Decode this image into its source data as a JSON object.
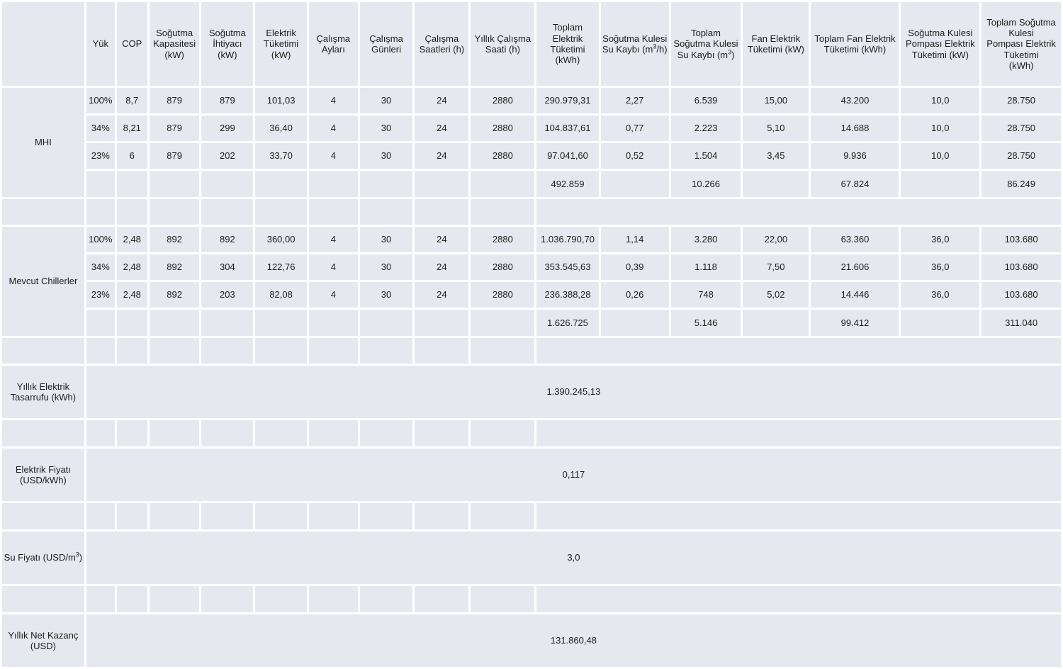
{
  "table": {
    "columns": [
      {
        "key": "group",
        "label": ""
      },
      {
        "key": "yuk",
        "label": "Yük"
      },
      {
        "key": "cop",
        "label": "COP"
      },
      {
        "key": "sogutma_kapasitesi",
        "label": "Soğutma Kapasitesi (kW)"
      },
      {
        "key": "sogutma_ihtiyaci",
        "label": "Soğutma İhtiyacı (kW)"
      },
      {
        "key": "elektrik_tuketimi",
        "label": "Elektrik Tüketimi (kW)"
      },
      {
        "key": "calisma_aylari",
        "label": "Çalışma Ayları"
      },
      {
        "key": "calisma_gunleri",
        "label": "Çalışma Günleri"
      },
      {
        "key": "calisma_saatleri",
        "label": "Çalışma Saatleri (h)"
      },
      {
        "key": "yillik_calisma_saati",
        "label": "Yıllık Çalışma Saati (h)"
      },
      {
        "key": "toplam_elektrik_tuketimi",
        "label": "Toplam Elektrik Tüketimi (kWh)"
      },
      {
        "key": "sk_su_kaybi",
        "label": "Soğutma Kulesi Su Kaybı (m³/h)"
      },
      {
        "key": "toplam_sk_su_kaybi",
        "label": "Toplam Soğutma Kulesi Su Kaybı (m³)"
      },
      {
        "key": "fan_elektrik_tuketimi",
        "label": "Fan Elektrik Tüketimi (kW)"
      },
      {
        "key": "toplam_fan_elektrik_tuketimi",
        "label": "Toplam Fan Elektrik Tüketimi (kWh)"
      },
      {
        "key": "sk_pompasi_elektrik_tuketimi",
        "label": "Soğutma Kulesi Pompası Elektrik Tüketimi (kW)"
      },
      {
        "key": "toplam_sk_pompasi_elektrik_tuketimi",
        "label": "Toplam Soğutma Kulesi Pompası Elektrik Tüketimi (kWh)"
      }
    ],
    "header_parts": {
      "c1": "Yük",
      "c2": "COP",
      "c3a": "Soğutma",
      "c3b": "Kapasitesi",
      "c3c": "(kW)",
      "c4a": "Soğutma",
      "c4b": "İhtiyacı (kW)",
      "c5a": "Elektrik",
      "c5b": "Tüketimi",
      "c5c": "(kW)",
      "c6a": "Çalışma",
      "c6b": "Ayları",
      "c7a": "Çalışma",
      "c7b": "Günleri",
      "c8a": "Çalışma",
      "c8b": "Saatleri (h)",
      "c9a": "Yıllık Çalışma",
      "c9b": "Saati (h)",
      "c10a": "Toplam Elektrik",
      "c10b": "Tüketimi (kWh)",
      "c11a": "Soğutma Kulesi",
      "c11b": "Su Kaybı (m",
      "c11sup": "3",
      "c11c": "/h)",
      "c12a": "Toplam",
      "c12b": "Soğutma Kulesi",
      "c12c": "Su Kaybı (m",
      "c12sup": "3",
      "c12d": ")",
      "c13a": "Fan Elektrik",
      "c13b": "Tüketimi (kW)",
      "c14a": "Toplam Fan Elektrik",
      "c14b": "Tüketimi (kWh)",
      "c15a": "Soğutma Kulesi",
      "c15b": "Pompası Elektrik",
      "c15c": "Tüketimi (kW)",
      "c16a": "Toplam Soğutma Kulesi",
      "c16b": "Pompası Elektrik Tüketimi",
      "c16c": "(kWh)"
    },
    "groups": [
      {
        "label": "MHI",
        "rows": [
          {
            "yuk": "100%",
            "cop": "8,7",
            "sogutma_kapasitesi": "879",
            "sogutma_ihtiyaci": "879",
            "elektrik_tuketimi": "101,03",
            "calisma_aylari": "4",
            "calisma_gunleri": "30",
            "calisma_saatleri": "24",
            "yillik_calisma_saati": "2880",
            "toplam_elektrik_tuketimi": "290.979,31",
            "sk_su_kaybi": "2,27",
            "toplam_sk_su_kaybi": "6.539",
            "fan_elektrik_tuketimi": "15,00",
            "toplam_fan_elektrik_tuketimi": "43.200",
            "sk_pompasi_elektrik_tuketimi": "10,0",
            "toplam_sk_pompasi_elektrik_tuketimi": "28.750"
          },
          {
            "yuk": "34%",
            "cop": "8,21",
            "sogutma_kapasitesi": "879",
            "sogutma_ihtiyaci": "299",
            "elektrik_tuketimi": "36,40",
            "calisma_aylari": "4",
            "calisma_gunleri": "30",
            "calisma_saatleri": "24",
            "yillik_calisma_saati": "2880",
            "toplam_elektrik_tuketimi": "104.837,61",
            "sk_su_kaybi": "0,77",
            "toplam_sk_su_kaybi": "2.223",
            "fan_elektrik_tuketimi": "5,10",
            "toplam_fan_elektrik_tuketimi": "14.688",
            "sk_pompasi_elektrik_tuketimi": "10,0",
            "toplam_sk_pompasi_elektrik_tuketimi": "28.750"
          },
          {
            "yuk": "23%",
            "cop": "6",
            "sogutma_kapasitesi": "879",
            "sogutma_ihtiyaci": "202",
            "elektrik_tuketimi": "33,70",
            "calisma_aylari": "4",
            "calisma_gunleri": "30",
            "calisma_saatleri": "24",
            "yillik_calisma_saati": "2880",
            "toplam_elektrik_tuketimi": "97.041,60",
            "sk_su_kaybi": "0,52",
            "toplam_sk_su_kaybi": "1.504",
            "fan_elektrik_tuketimi": "3,45",
            "toplam_fan_elektrik_tuketimi": "9.936",
            "sk_pompasi_elektrik_tuketimi": "10,0",
            "toplam_sk_pompasi_elektrik_tuketimi": "28.750"
          }
        ],
        "totals": {
          "yuk": "",
          "cop": "",
          "sogutma_kapasitesi": "",
          "sogutma_ihtiyaci": "",
          "elektrik_tuketimi": "",
          "calisma_aylari": "",
          "calisma_gunleri": "",
          "calisma_saatleri": "",
          "yillik_calisma_saati": "",
          "toplam_elektrik_tuketimi": "492.859",
          "sk_su_kaybi": "",
          "toplam_sk_su_kaybi": "10.266",
          "fan_elektrik_tuketimi": "",
          "toplam_fan_elektrik_tuketimi": "67.824",
          "sk_pompasi_elektrik_tuketimi": "",
          "toplam_sk_pompasi_elektrik_tuketimi": "86.249"
        }
      },
      {
        "label": "Mevcut Chillerler",
        "rows": [
          {
            "yuk": "100%",
            "cop": "2,48",
            "sogutma_kapasitesi": "892",
            "sogutma_ihtiyaci": "892",
            "elektrik_tuketimi": "360,00",
            "calisma_aylari": "4",
            "calisma_gunleri": "30",
            "calisma_saatleri": "24",
            "yillik_calisma_saati": "2880",
            "toplam_elektrik_tuketimi": "1.036.790,70",
            "sk_su_kaybi": "1,14",
            "toplam_sk_su_kaybi": "3.280",
            "fan_elektrik_tuketimi": "22,00",
            "toplam_fan_elektrik_tuketimi": "63.360",
            "sk_pompasi_elektrik_tuketimi": "36,0",
            "toplam_sk_pompasi_elektrik_tuketimi": "103.680"
          },
          {
            "yuk": "34%",
            "cop": "2,48",
            "sogutma_kapasitesi": "892",
            "sogutma_ihtiyaci": "304",
            "elektrik_tuketimi": "122,76",
            "calisma_aylari": "4",
            "calisma_gunleri": "30",
            "calisma_saatleri": "24",
            "yillik_calisma_saati": "2880",
            "toplam_elektrik_tuketimi": "353.545,63",
            "sk_su_kaybi": "0,39",
            "toplam_sk_su_kaybi": "1.118",
            "fan_elektrik_tuketimi": "7,50",
            "toplam_fan_elektrik_tuketimi": "21.606",
            "sk_pompasi_elektrik_tuketimi": "36,0",
            "toplam_sk_pompasi_elektrik_tuketimi": "103.680"
          },
          {
            "yuk": "23%",
            "cop": "2,48",
            "sogutma_kapasitesi": "892",
            "sogutma_ihtiyaci": "203",
            "elektrik_tuketimi": "82,08",
            "calisma_aylari": "4",
            "calisma_gunleri": "30",
            "calisma_saatleri": "24",
            "yillik_calisma_saati": "2880",
            "toplam_elektrik_tuketimi": "236.388,28",
            "sk_su_kaybi": "0,26",
            "toplam_sk_su_kaybi": "748",
            "fan_elektrik_tuketimi": "5,02",
            "toplam_fan_elektrik_tuketimi": "14.446",
            "sk_pompasi_elektrik_tuketimi": "36,0",
            "toplam_sk_pompasi_elektrik_tuketimi": "103.680"
          }
        ],
        "totals": {
          "yuk": "",
          "cop": "",
          "sogutma_kapasitesi": "",
          "sogutma_ihtiyaci": "",
          "elektrik_tuketimi": "",
          "calisma_aylari": "",
          "calisma_gunleri": "",
          "calisma_saatleri": "",
          "yillik_calisma_saati": "",
          "toplam_elektrik_tuketimi": "1.626.725",
          "sk_su_kaybi": "",
          "toplam_sk_su_kaybi": "5.146",
          "fan_elektrik_tuketimi": "",
          "toplam_fan_elektrik_tuketimi": "99.412",
          "sk_pompasi_elektrik_tuketimi": "",
          "toplam_sk_pompasi_elektrik_tuketimi": "311.040"
        }
      }
    ],
    "summaries": [
      {
        "label_line1": "Yıllık Elektrik",
        "label_line2": "Tasarrufu (kWh)",
        "value": "1.390.245,13"
      },
      {
        "label_line1": "Elektrik Fiyatı",
        "label_line2": "(USD/kWh)",
        "value": "0,117"
      },
      {
        "label_line1": "Su Fiyatı (USD/m",
        "label_sup": "3",
        "label_line2": ")",
        "value": "3,0"
      },
      {
        "label_line1": "Yıllık Net Kazanç",
        "label_line2": "(USD)",
        "value": "131.860,48"
      }
    ]
  },
  "colors": {
    "cell_bg": "#e6e8ef",
    "grid_gap": "#ffffff",
    "text": "#1c1c1c"
  }
}
